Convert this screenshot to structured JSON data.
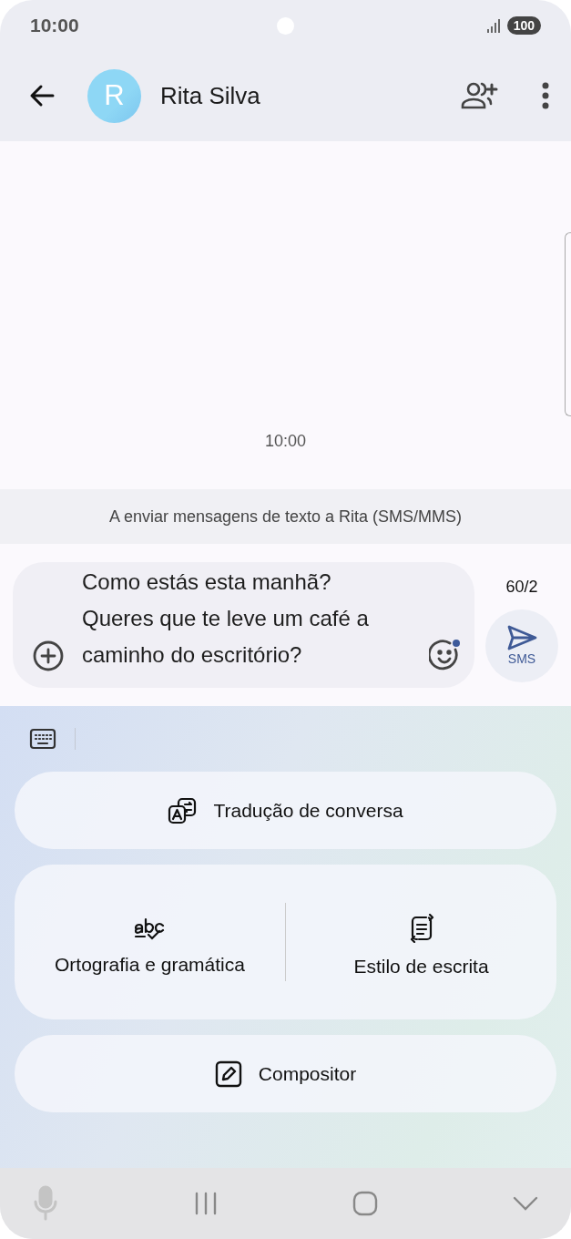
{
  "status_bar": {
    "time": "10:00",
    "battery": "100"
  },
  "app_bar": {
    "avatar_letter": "R",
    "contact_name": "Rita Silva"
  },
  "conversation": {
    "timestamp": "10:00"
  },
  "banner": "A enviar mensagens de texto a Rita (SMS/MMS)",
  "composer": {
    "value": "Como estás esta manhã?\nQueres que te leve um café a\ncaminho do escritório?",
    "counter": "60/2",
    "send_label": "SMS"
  },
  "writing_assist": {
    "items": [
      {
        "kind": "wide",
        "label": "Tradução de conversa"
      },
      {
        "kind": "split",
        "parts": [
          {
            "label": "Ortografia e gramática"
          },
          {
            "label": "Estilo de escrita"
          }
        ]
      },
      {
        "kind": "wide",
        "label": "Compositor"
      }
    ]
  }
}
